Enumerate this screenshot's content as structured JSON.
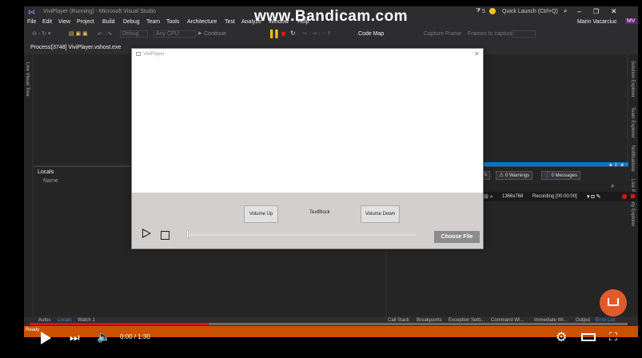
{
  "watermark": "www.Bandicam.com",
  "vs": {
    "window_title": "ViviPlayer (Running) - Microsoft Visual Studio",
    "menu": [
      "File",
      "Edit",
      "View",
      "Project",
      "Build",
      "Debug",
      "Team",
      "Tools",
      "Architecture",
      "Test",
      "Analyze",
      "Window",
      "Help"
    ],
    "quick_launch": "Quick Launch (Ctrl+Q)",
    "user": "Marin Vacarciuc",
    "user_initials": "MV",
    "notif_count": "5",
    "toolbar": {
      "config": "Debug",
      "platform": "Any CPU",
      "continue": "Continue",
      "code_map": "Code Map",
      "capture_frame": "Capture Frame",
      "frames_to_capture": "Frames to capture:"
    },
    "process_label": "Process:",
    "process_value": "[3748] ViviPlayer.vshost.exe",
    "left_vertical": "Live Visual Tree",
    "right_vertical": [
      "Solution Explorer",
      "Team Explorer",
      "Notifications",
      "Live Property Explorer"
    ],
    "locals_title": "Locals",
    "locals_col": "Name",
    "errors_suffix": "rs",
    "warnings": "0 Warnings",
    "messages": "0 Messages",
    "bottom_tabs_left": [
      "Autos",
      "Locals",
      "Watch 1"
    ],
    "bottom_tabs_right": [
      "Call Stack",
      "Breakpoints",
      "Exception Setti...",
      "Command Wi...",
      "Immediate Wi...",
      "Output",
      "Error List"
    ],
    "status": "Ready"
  },
  "recording": {
    "resolution": "1366x768",
    "label": "Recording [00:00:00]"
  },
  "app": {
    "title": "ViviPlayer",
    "volume_up": "Volume Up",
    "textblock": "TextBlock",
    "volume_down": "Volume Down",
    "choose_file": "Choose File",
    "slider_value": 0
  },
  "video": {
    "time": "0:00 / 1:30",
    "progress": 0.3
  },
  "colors": {
    "vs_bg": "#2d2d30",
    "statusbar": "#ca5100",
    "accent": "#007acc",
    "yt_red": "#cc181e"
  }
}
